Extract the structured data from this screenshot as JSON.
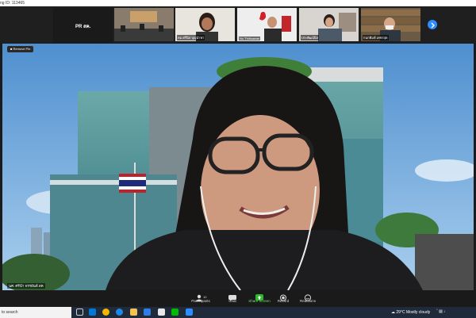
{
  "window": {
    "meeting_id": "ng ID: 113465"
  },
  "gallery": {
    "host_label": "PR สค.",
    "host_sub": "PR สค.",
    "participants": [
      {
        "name": ""
      },
      {
        "name": "คม.ศรีนิล บุญนำพา"
      },
      {
        "name": "Nu Thitisawan"
      },
      {
        "name": "ประพัฒน์นิล"
      },
      {
        "name": "กนกพิมพ์ เพชรสุด"
      }
    ],
    "next_icon": "chevron-right-icon"
  },
  "video": {
    "remove_pin": "Remove Pin",
    "speaker_name": "นศ. ศรีนำ จรรยันต์ สค"
  },
  "controls": {
    "participants": "Participants",
    "participants_count": "10",
    "chat": "Chat",
    "share_screen": "Share Screen",
    "record": "Record",
    "reactions": "Reactions"
  },
  "taskbar": {
    "search": "to search",
    "weather_temp": "29°C",
    "weather_text": "Mostly cloudy"
  },
  "colors": {
    "share_green": "#2db82d",
    "taskbar": "#1f2a3a",
    "next_blue": "#2d8cff"
  }
}
